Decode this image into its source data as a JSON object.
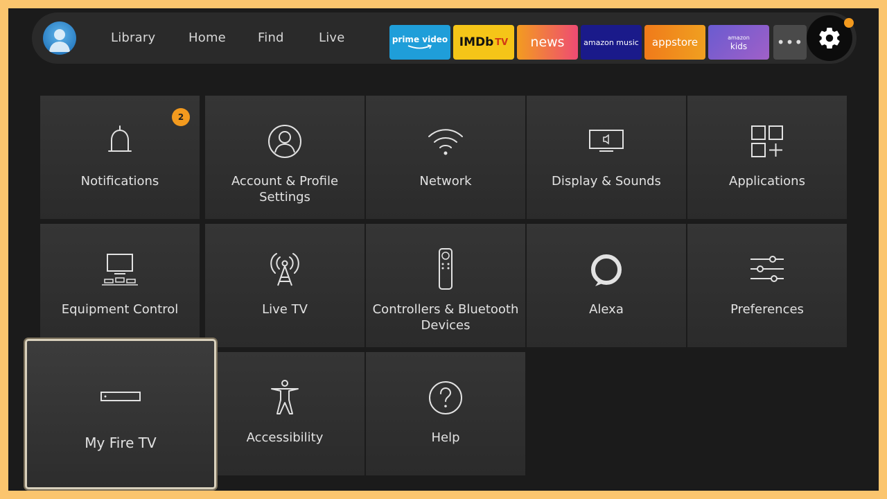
{
  "nav": {
    "items": [
      "Library",
      "Home",
      "Find",
      "Live"
    ],
    "apps": {
      "prime_line1": "prime video",
      "imdb": "IMDb",
      "imdb_tv": "TV",
      "news": "news",
      "music": "amazon music",
      "appstore": "appstore",
      "kids_top": "amazon",
      "kids": "kids"
    },
    "more": "•••"
  },
  "notifications_badge": "2",
  "tiles": [
    {
      "label": "Notifications",
      "icon": "bell-icon"
    },
    {
      "label": "Account & Profile Settings",
      "icon": "person-icon"
    },
    {
      "label": "Network",
      "icon": "wifi-icon"
    },
    {
      "label": "Display & Sounds",
      "icon": "display-icon"
    },
    {
      "label": "Applications",
      "icon": "apps-grid-icon"
    },
    {
      "label": "Equipment Control",
      "icon": "equipment-icon"
    },
    {
      "label": "Live TV",
      "icon": "antenna-icon"
    },
    {
      "label": "Controllers & Bluetooth Devices",
      "icon": "remote-icon"
    },
    {
      "label": "Alexa",
      "icon": "alexa-ring-icon"
    },
    {
      "label": "Preferences",
      "icon": "sliders-icon"
    },
    {
      "label": "My Fire TV",
      "icon": "fire-tv-device-icon"
    },
    {
      "label": "Accessibility",
      "icon": "accessibility-icon"
    },
    {
      "label": "Help",
      "icon": "help-icon"
    }
  ],
  "colors": {
    "frame": "#fbc56e",
    "background": "#1b1b1b",
    "accent": "#f39a1e"
  }
}
